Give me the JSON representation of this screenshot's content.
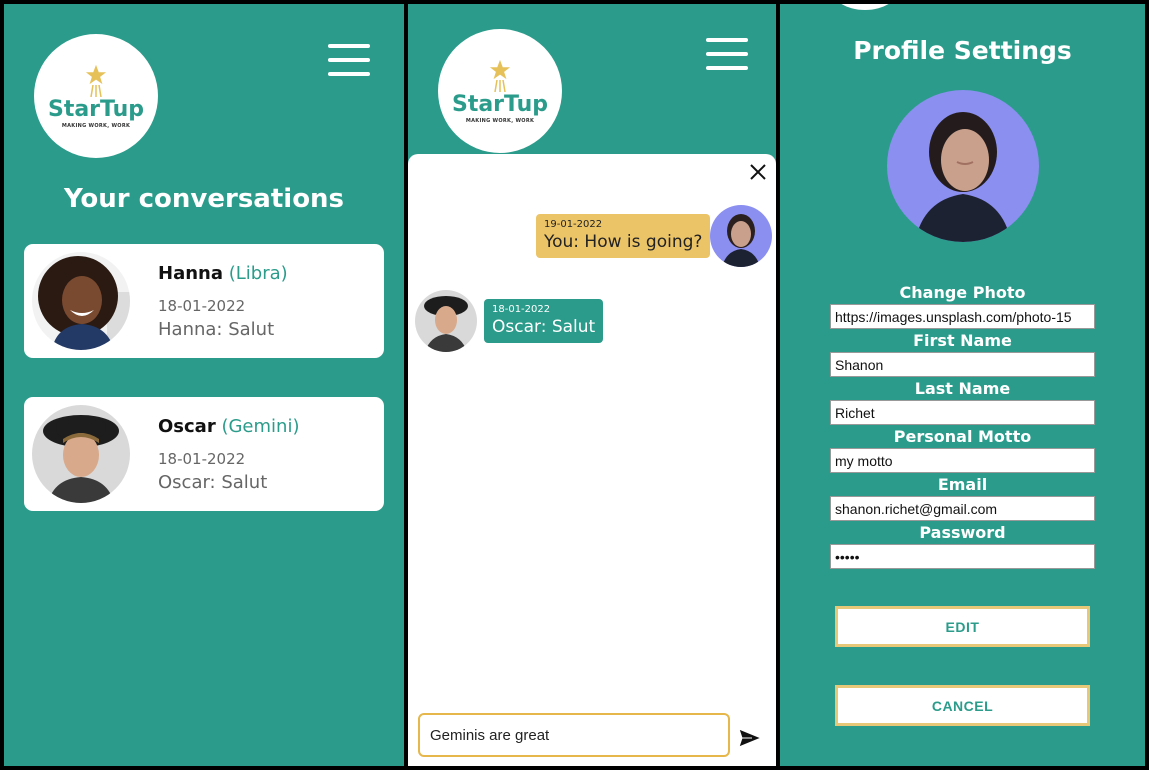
{
  "colors": {
    "primary": "#2b9c8b",
    "accent": "#ecc468",
    "white": "#ffffff"
  },
  "logo": {
    "brand": "StarTup",
    "tagline": "MAKING WORK, WORK"
  },
  "conversations_screen": {
    "title": "Your conversations",
    "items": [
      {
        "name": "Hanna",
        "sign": "(Libra)",
        "date": "18-01-2022",
        "last_message": "Hanna: Salut"
      },
      {
        "name": "Oscar",
        "sign": "(Gemini)",
        "date": "18-01-2022",
        "last_message": "Oscar: Salut"
      }
    ]
  },
  "chat_screen": {
    "messages": [
      {
        "from": "me",
        "date": "19-01-2022",
        "text": "You: How is going?"
      },
      {
        "from": "them",
        "date": "18-01-2022",
        "text": "Oscar: Salut"
      }
    ],
    "input_value": "Geminis are great",
    "close_icon": "close-icon",
    "send_icon": "send-icon"
  },
  "profile_screen": {
    "title": "Profile Settings",
    "fields": [
      {
        "label": "Change Photo",
        "value": "https://images.unsplash.com/photo-15"
      },
      {
        "label": "First Name",
        "value": "Shanon"
      },
      {
        "label": "Last Name",
        "value": "Richet"
      },
      {
        "label": "Personal Motto",
        "value": "my motto"
      },
      {
        "label": "Email",
        "value": "shanon.richet@gmail.com"
      },
      {
        "label": "Password",
        "value": "•••••"
      }
    ],
    "edit_label": "EDIT",
    "cancel_label": "CANCEL"
  }
}
